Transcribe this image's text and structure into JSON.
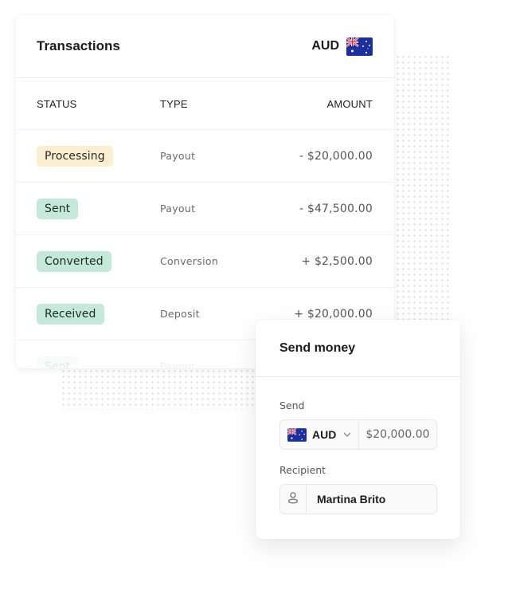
{
  "transactions": {
    "title": "Transactions",
    "currency": {
      "code": "AUD",
      "flag_icon": "australia-flag-icon"
    },
    "columns": {
      "status": "STATUS",
      "type": "TYPE",
      "amount": "AMOUNT"
    },
    "rows": [
      {
        "status": "Processing",
        "status_color": "#fdeecf",
        "type": "Payout",
        "amount": "- $20,000.00"
      },
      {
        "status": "Sent",
        "status_color": "#c3ead9",
        "type": "Payout",
        "amount": "- $47,500.00"
      },
      {
        "status": "Converted",
        "status_color": "#c3ead9",
        "type": "Conversion",
        "amount": "+ $2,500.00"
      },
      {
        "status": "Received",
        "status_color": "#c3ead9",
        "type": "Deposit",
        "amount": "+ $20,000.00"
      },
      {
        "status": "Sent",
        "status_color": "#c3ead9",
        "type": "Payout",
        "amount": ""
      }
    ]
  },
  "send_money": {
    "title": "Send money",
    "send_label": "Send",
    "currency_code": "AUD",
    "chevron_icon": "chevron-down-icon",
    "amount_value": "$20,000.00",
    "recipient_label": "Recipient",
    "recipient_icon": "person-icon",
    "recipient_name": "Martina Brito"
  }
}
